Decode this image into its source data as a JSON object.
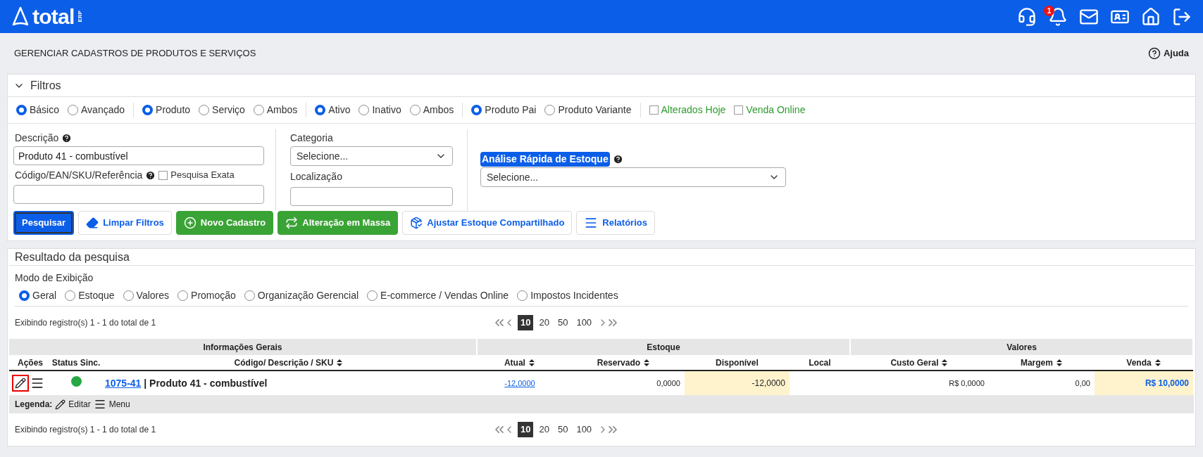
{
  "header": {
    "logo": "total",
    "logo_tag": "ERP",
    "notification_count": "1"
  },
  "page": {
    "title": "GERENCIAR CADASTROS DE PRODUTOS E SERVIÇOS",
    "help": "Ajuda"
  },
  "filters": {
    "title": "Filtros",
    "expanded": true,
    "radio_groups": [
      [
        {
          "label": "Básico",
          "selected": true
        },
        {
          "label": "Avançado",
          "selected": false
        }
      ],
      [
        {
          "label": "Produto",
          "selected": true
        },
        {
          "label": "Serviço",
          "selected": false
        },
        {
          "label": "Ambos",
          "selected": false
        }
      ],
      [
        {
          "label": "Ativo",
          "selected": true
        },
        {
          "label": "Inativo",
          "selected": false
        },
        {
          "label": "Ambos",
          "selected": false
        }
      ],
      [
        {
          "label": "Produto Pai",
          "selected": true
        },
        {
          "label": "Produto Variante",
          "selected": false
        }
      ]
    ],
    "checkboxes": [
      {
        "label": "Alterados Hoje",
        "checked": false
      },
      {
        "label": "Venda Online",
        "checked": false
      }
    ],
    "descricao": {
      "label": "Descrição",
      "value": "Produto 41 - combustível"
    },
    "codigo": {
      "label": "Código/EAN/SKU/Referência",
      "exact": {
        "label": "Pesquisa Exata",
        "checked": false
      }
    },
    "categoria": {
      "label": "Categoria",
      "value": "Selecione..."
    },
    "localizacao": {
      "label": "Localização"
    },
    "analise": {
      "label": "Análise Rápida de Estoque",
      "value": "Selecione..."
    },
    "buttons": [
      {
        "label": "Pesquisar",
        "kind": "primary"
      },
      {
        "label": "Limpar Filtros",
        "kind": "eraser"
      },
      {
        "label": "Novo Cadastro",
        "kind": "add"
      },
      {
        "label": "Alteração em Massa",
        "kind": "bulk"
      },
      {
        "label": "Ajustar Estoque Compartilhado",
        "kind": "stock"
      },
      {
        "label": "Relatórios",
        "kind": "reports"
      }
    ]
  },
  "results": {
    "title": "Resultado da pesquisa",
    "mode_label": "Modo de Exibição",
    "modes": [
      {
        "label": "Geral",
        "selected": true
      },
      {
        "label": "Estoque",
        "selected": false
      },
      {
        "label": "Valores",
        "selected": false
      },
      {
        "label": "Promoção",
        "selected": false
      },
      {
        "label": "Organização Gerencial",
        "selected": false
      },
      {
        "label": "E-commerce / Vendas Online",
        "selected": false
      },
      {
        "label": "Impostos Incidentes",
        "selected": false
      }
    ],
    "info_top": "Exibindo registro(s) 1 - 1 do total de 1",
    "pages_top": [
      {
        "label": "10",
        "selected": true
      },
      {
        "label": "20",
        "selected": false
      },
      {
        "label": "50",
        "selected": false
      },
      {
        "label": "100",
        "selected": false
      }
    ],
    "groups": [
      {
        "label": "Informações Gerais"
      },
      {
        "label": "Estoque"
      },
      {
        "label": "Valores"
      }
    ],
    "columns": [
      {
        "label": "Ações",
        "sortable": false,
        "highlight": false
      },
      {
        "label": "Status Sinc.",
        "sortable": false,
        "highlight": false
      },
      {
        "label": "Código/ Descrição / SKU",
        "sortable": true,
        "highlight": false
      },
      {
        "label": "Atual",
        "sortable": true,
        "highlight": false
      },
      {
        "label": "Reservado",
        "sortable": true,
        "highlight": false
      },
      {
        "label": "Disponível",
        "sortable": false,
        "highlight": true
      },
      {
        "label": "Local",
        "sortable": false,
        "highlight": false
      },
      {
        "label": "Custo Geral",
        "sortable": true,
        "highlight": false
      },
      {
        "label": "Margem",
        "sortable": true,
        "highlight": false
      },
      {
        "label": "Venda",
        "sortable": true,
        "highlight": true
      }
    ],
    "rows": [
      {
        "edit_focused": true,
        "color": "#28a745",
        "code": "1075-41",
        "description": "| Produto 41 - combustível",
        "atual": "-12,0000",
        "reservado": "0,0000",
        "disponivel": "-12,0000",
        "custo": "R$ 0,0000",
        "margem": "0,00",
        "venda": "R$ 10,0000"
      }
    ],
    "legend": {
      "label": "Legenda:",
      "edit": "Editar",
      "menu": "Menu"
    },
    "info_bottom": "Exibindo registro(s) 1 - 1 do total de 1",
    "pages_bottom": [
      {
        "label": "10",
        "selected": true
      },
      {
        "label": "20",
        "selected": false
      },
      {
        "label": "50",
        "selected": false
      },
      {
        "label": "100",
        "selected": false
      }
    ]
  }
}
